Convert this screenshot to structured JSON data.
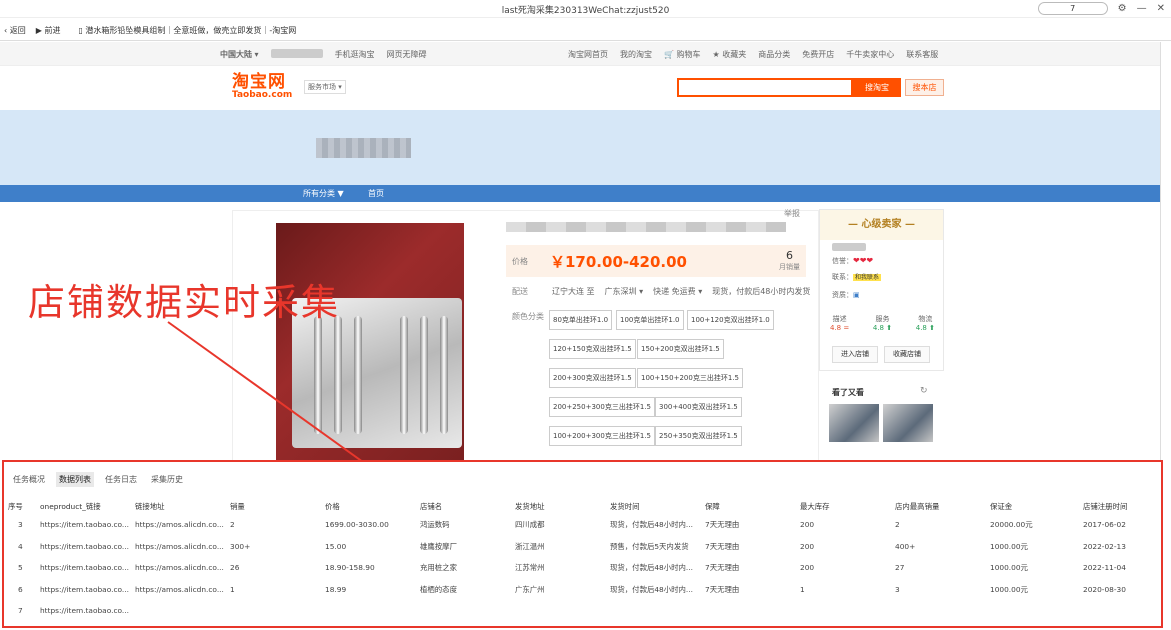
{
  "browser": {
    "window_title": "last死淘采集230313WeChat:zzjust520",
    "counter": "7",
    "back_label": "返回",
    "forward_label": "前进",
    "tab_title": "潜水箱形铅坠模具组制｜全意班做，做壳立即发货｜-淘宝网"
  },
  "taobao_top": {
    "region": "中国大陆",
    "mobile": "手机逛淘宝",
    "accessible": "网页无障碍",
    "home": "淘宝网首页",
    "my_taobao": "我的淘宝",
    "cart": "购物车",
    "favorites": "收藏夹",
    "categories": "商品分类",
    "free_open": "免费开店",
    "seller_center": "千牛卖家中心",
    "service": "联系客服"
  },
  "header": {
    "logo_cn": "淘宝网",
    "logo_en": "Taobao.com",
    "market": "服务市场",
    "search_button": "搜淘宝",
    "search_shop": "搜本店",
    "search_placeholder": ""
  },
  "shop_nav": {
    "all_categories": "所有分类 ▼",
    "home": "首页"
  },
  "product": {
    "report": "举报",
    "price_label": "价格",
    "price": "￥170.00-420.00",
    "monthly_sales": "6",
    "monthly_sales_label": "月销量",
    "ship_label": "配送",
    "ship_from": "辽宁大连 至",
    "ship_to": "广东深圳 ▾",
    "ship_fee": "快递 免运费 ▾",
    "ship_time": "现货，付款后48小时内发货",
    "color_label": "颜色分类",
    "skus": [
      "80克单出挂环1.0",
      "100克单出挂环1.0",
      "100+120克双出挂环1.0",
      "120+150克双出挂环1.5",
      "150+200克双出挂环1.5",
      "200+300克双出挂环1.5",
      "100+150+200克三出挂环1.5",
      "200+250+300克三出挂环1.5",
      "300+400克双出挂环1.5",
      "100+200+300克三出挂环1.5",
      "250+350克双出挂环1.5"
    ]
  },
  "seller": {
    "level_title": "— 心级卖家 —",
    "credit_label": "信誉：",
    "hearts": "❤❤❤",
    "contact_label": "联系：",
    "contact_badge": "和我联系",
    "qualification_label": "资质：",
    "dsr": [
      {
        "name": "描述",
        "value": "4.8 ="
      },
      {
        "name": "服务",
        "value": "4.8 ⬆"
      },
      {
        "name": "物流",
        "value": "4.8 ⬆"
      }
    ],
    "enter_shop": "进入店铺",
    "fav_shop": "收藏店铺",
    "see_also": "看了又看"
  },
  "annotation": {
    "big_text": "店铺数据实时采集"
  },
  "collector": {
    "tabs": [
      "任务概况",
      "数据列表",
      "任务日志",
      "采集历史"
    ],
    "active_tab": 1,
    "columns": [
      "序号",
      "oneproduct_链接",
      "链接地址",
      "销量",
      "价格",
      "店铺名",
      "发货地址",
      "发货时间",
      "保障",
      "最大库存",
      "店内最高销量",
      "保证金",
      "店铺注册时间"
    ],
    "rows": [
      [
        "3",
        "https://item.taobao.co...",
        "https://amos.alicdn.co...",
        "2",
        "1699.00-3030.00",
        "鸿运数码",
        "四川成都",
        "现货，付款后48小时内...",
        "7天无理由",
        "200",
        "2",
        "20000.00元",
        "2017-06-02"
      ],
      [
        "4",
        "https://item.taobao.co...",
        "https://amos.alicdn.co...",
        "300+",
        "15.00",
        "雄鹰按摩厂",
        "浙江温州",
        "预售，付款后5天内发货",
        "7天无理由",
        "200",
        "400+",
        "1000.00元",
        "2022-02-13"
      ],
      [
        "5",
        "https://item.taobao.co...",
        "https://amos.alicdn.co...",
        "26",
        "18.90-158.90",
        "充用桩之家",
        "江苏常州",
        "现货，付款后48小时内...",
        "7天无理由",
        "200",
        "27",
        "1000.00元",
        "2022-11-04"
      ],
      [
        "6",
        "https://item.taobao.co...",
        "https://amos.alicdn.co...",
        "1",
        "18.99",
        "植栖的态度",
        "广东广州",
        "现货，付款后48小时内...",
        "7天无理由",
        "1",
        "3",
        "1000.00元",
        "2020-08-30"
      ],
      [
        "7",
        "https://item.taobao.co...",
        "",
        "",
        "",
        "",
        "",
        "",
        "",
        "",
        "",
        "",
        ""
      ]
    ]
  },
  "colors": {
    "taobao_orange": "#ff5000",
    "annotation_red": "#e8362b",
    "shop_nav_blue": "#3f7fc9"
  }
}
